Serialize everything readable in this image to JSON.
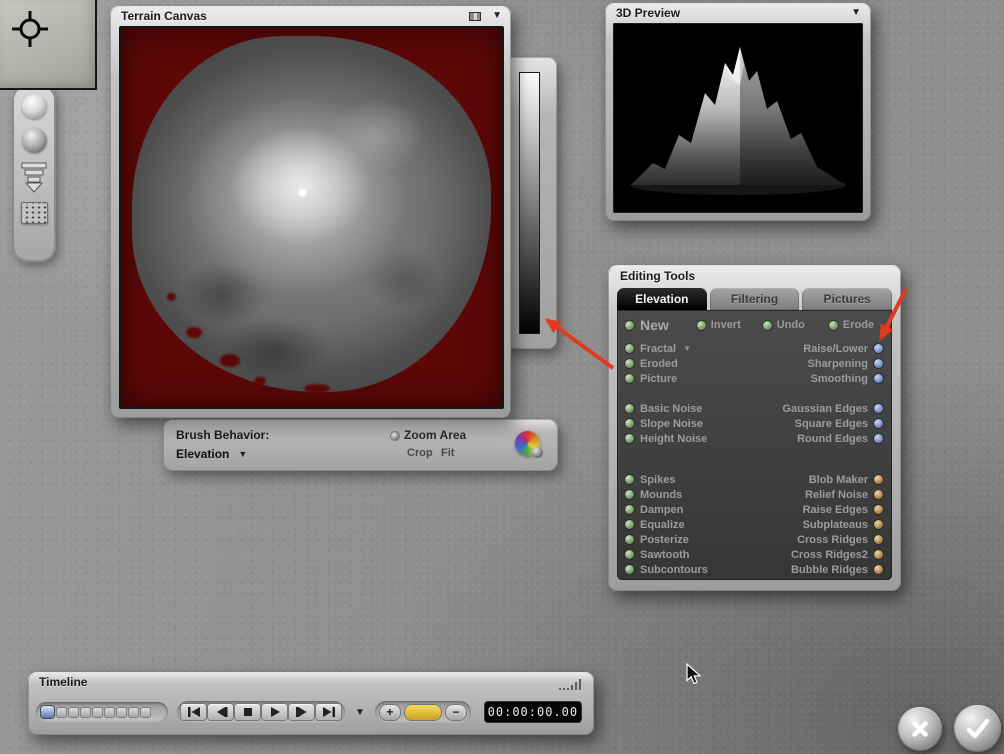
{
  "colors": {
    "annotation_red": "#e23a20",
    "canvas_red": "#5d0707",
    "dot_green": "#7fa071",
    "dot_blue": "#8193c8",
    "dot_tan": "#b08f52"
  },
  "terrain_window": {
    "title": "Terrain Canvas",
    "collapse_icon": "▼"
  },
  "brush_panel": {
    "behavior_label": "Brush Behavior:",
    "mode_value": "Elevation",
    "mode_dropdown_icon": "▼",
    "zoom_area_label": "Zoom Area",
    "crop_label": "Crop",
    "fit_label": "Fit"
  },
  "preview_window": {
    "title": "3D Preview",
    "collapse_icon": "▼"
  },
  "editing_tools": {
    "title": "Editing Tools",
    "tabs": [
      {
        "label": "Elevation",
        "active": true
      },
      {
        "label": "Filtering",
        "active": false
      },
      {
        "label": "Pictures",
        "active": false
      }
    ],
    "actions": {
      "new": "New",
      "invert": "Invert",
      "undo": "Undo",
      "erode": "Erode"
    },
    "fractal_dropdown_icon": "▼",
    "group1_left": [
      "Fractal",
      "Eroded",
      "Picture"
    ],
    "group1_right": [
      "Raise/Lower",
      "Sharpening",
      "Smoothing"
    ],
    "group2_left": [
      "Basic Noise",
      "Slope Noise",
      "Height Noise"
    ],
    "group2_right": [
      "Gaussian Edges",
      "Square Edges",
      "Round Edges"
    ],
    "group3_left": [
      "Spikes",
      "Mounds",
      "Dampen",
      "Equalize",
      "Posterize",
      "Sawtooth",
      "Subcontours"
    ],
    "group3_right": [
      "Blob Maker",
      "Relief Noise",
      "Raise Edges",
      "Subplateaus",
      "Cross Ridges",
      "Cross Ridges2",
      "Bubble Ridges"
    ]
  },
  "timeline": {
    "title": "Timeline",
    "options_icon": "▼",
    "add_label": "+",
    "remove_label": "−",
    "time_display": "00:00:00.00"
  }
}
